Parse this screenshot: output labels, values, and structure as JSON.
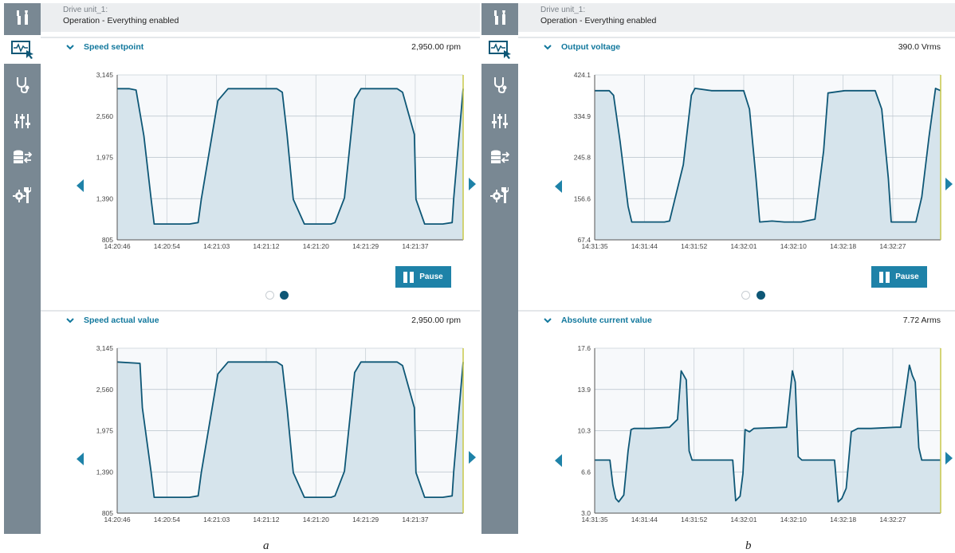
{
  "colors": {
    "sidebar": "#798893",
    "accent": "#1e82a8",
    "title": "#12789d",
    "line": "#0e5776",
    "fill": "#d6e4ec",
    "plot_bg": "#f7f9fb",
    "cursor": "#c8c84a"
  },
  "sidebar_icons": [
    "tools-icon",
    "monitor-trace-icon",
    "stethoscope-icon",
    "sliders-icon",
    "database-transfer-icon",
    "settings-wrench-icon"
  ],
  "panels": [
    {
      "caption": "a",
      "header": {
        "unit": "Drive unit_1:",
        "state": "Operation - Everything enabled"
      },
      "charts": [
        {
          "title": "Speed setpoint",
          "value": "2,950.00 rpm"
        },
        {
          "title": "Speed actual value",
          "value": "2,950.00 rpm"
        }
      ],
      "pause_label": "Pause",
      "pager": {
        "pages": 2,
        "active": 1
      }
    },
    {
      "caption": "b",
      "header": {
        "unit": "Drive unit_1:",
        "state": "Operation - Everything enabled"
      },
      "charts": [
        {
          "title": "Output voltage",
          "value": "390.0 Vrms"
        },
        {
          "title": "Absolute current value",
          "value": "7.72 Arms"
        }
      ],
      "pause_label": "Pause",
      "pager": {
        "pages": 2,
        "active": 1
      }
    }
  ],
  "chart_data": [
    {
      "type": "area",
      "title": "Speed setpoint",
      "unit": "rpm",
      "ylim": [
        805,
        3145
      ],
      "y_ticks": [
        "3,145",
        "2,560",
        "1,975",
        "1,390",
        "805"
      ],
      "x_ticks": [
        "14:20:46",
        "14:20:54",
        "14:21:03",
        "14:21:12",
        "14:21:20",
        "14:21:29",
        "14:21:37"
      ],
      "x_seconds": [
        0,
        1.5,
        2.4,
        3.4,
        4.3,
        4.7,
        6.3,
        7.4,
        9.2,
        10.3,
        10.7,
        12.8,
        14.1,
        15.1,
        16.1,
        16.6,
        18.2,
        19.0,
        20.3,
        21.0,
        21.6,
        22.4,
        23.8,
        24.6,
        26.2,
        27.2,
        27.7,
        28.9,
        30.2,
        31.0,
        32.1,
        33.8,
        34.5,
        35.6,
        36.3,
        37.8,
        38.0,
        39.1,
        40.5,
        41.4,
        42.6,
        42.8,
        44.0
      ],
      "values": [
        2950,
        2950,
        2930,
        2280,
        1400,
        1030,
        1030,
        1030,
        1030,
        1050,
        1380,
        2780,
        2950,
        2950,
        2950,
        2950,
        2950,
        2950,
        2950,
        2900,
        2300,
        1380,
        1030,
        1030,
        1030,
        1030,
        1050,
        1400,
        2800,
        2950,
        2950,
        2950,
        2950,
        2950,
        2900,
        2300,
        1380,
        1030,
        1030,
        1030,
        1050,
        1400,
        2950
      ],
      "x_end": 44.0,
      "grid": true
    },
    {
      "type": "area",
      "title": "Speed actual value",
      "unit": "rpm",
      "ylim": [
        805,
        3145
      ],
      "y_ticks": [
        "3,145",
        "2,560",
        "1,975",
        "1,390",
        "805"
      ],
      "x_ticks": [
        "14:20:46",
        "14:20:54",
        "14:21:03",
        "14:21:12",
        "14:21:20",
        "14:21:29",
        "14:21:37"
      ],
      "x_seconds": [
        0,
        2.9,
        3.2,
        4.3,
        4.7,
        6.3,
        7.4,
        9.2,
        10.3,
        10.7,
        12.8,
        14.1,
        15.1,
        16.1,
        16.6,
        18.2,
        19.0,
        20.3,
        21.0,
        21.6,
        22.4,
        23.8,
        24.6,
        26.2,
        27.2,
        27.7,
        28.9,
        30.2,
        31.0,
        32.1,
        33.8,
        34.5,
        35.6,
        36.3,
        37.8,
        38.0,
        39.1,
        40.5,
        41.4,
        42.6,
        42.8,
        44.0
      ],
      "values": [
        2950,
        2930,
        2300,
        1400,
        1030,
        1030,
        1030,
        1030,
        1050,
        1380,
        2780,
        2950,
        2950,
        2950,
        2950,
        2950,
        2950,
        2950,
        2900,
        2300,
        1380,
        1030,
        1030,
        1030,
        1030,
        1050,
        1400,
        2800,
        2950,
        2950,
        2950,
        2950,
        2950,
        2900,
        2300,
        1380,
        1030,
        1030,
        1030,
        1050,
        1400,
        2950
      ],
      "x_end": 44.0,
      "grid": true
    },
    {
      "type": "area",
      "title": "Output voltage",
      "unit": "Vrms",
      "ylim": [
        67.4,
        424.1
      ],
      "y_ticks": [
        "424.1",
        "334.9",
        "245.8",
        "156.6",
        "67.4"
      ],
      "x_ticks": [
        "14:31:35",
        "14:31:44",
        "14:31:52",
        "14:32:01",
        "14:32:10",
        "14:32:18",
        "14:32:27"
      ],
      "x_seconds": [
        0,
        2.0,
        2.6,
        3.5,
        4.6,
        5.1,
        6.4,
        8.0,
        9.6,
        10.3,
        12.2,
        13.3,
        13.8,
        16.1,
        18.3,
        20.1,
        20.5,
        21.3,
        22.2,
        22.7,
        24.4,
        26.1,
        27.4,
        28.4,
        30.3,
        31.5,
        32.1,
        34.4,
        36.2,
        38.3,
        38.6,
        39.5,
        40.4,
        40.8,
        42.5,
        43.6,
        44.2,
        45.0,
        46.0,
        46.9,
        47.6
      ],
      "values": [
        390,
        390,
        380,
        280,
        140,
        106,
        106,
        106,
        106,
        108,
        230,
        380,
        395,
        390,
        390,
        390,
        390,
        350,
        200,
        106,
        108,
        106,
        106,
        106,
        112,
        260,
        385,
        390,
        390,
        390,
        390,
        350,
        200,
        106,
        106,
        106,
        106,
        160,
        290,
        395,
        390
      ],
      "x_end": 47.6,
      "grid": true
    },
    {
      "type": "area",
      "title": "Absolute current value",
      "unit": "Arms",
      "ylim": [
        3.0,
        17.6
      ],
      "y_ticks": [
        "17.6",
        "13.9",
        "10.3",
        "6.6",
        "3.0"
      ],
      "x_ticks": [
        "14:31:35",
        "14:31:44",
        "14:31:52",
        "14:32:01",
        "14:32:10",
        "14:32:18",
        "14:32:27"
      ],
      "x_seconds": [
        0,
        2.1,
        2.5,
        2.9,
        3.3,
        4.0,
        4.6,
        5.0,
        5.4,
        7.5,
        10.3,
        11.4,
        11.9,
        12.6,
        13.0,
        13.4,
        14.0,
        15.2,
        19.0,
        19.4,
        20.0,
        20.4,
        20.7,
        21.3,
        21.9,
        26.4,
        27.2,
        27.6,
        28.0,
        28.5,
        29.4,
        31.9,
        33.0,
        33.5,
        34.0,
        34.6,
        35.3,
        36.2,
        38.0,
        41.5,
        42.1,
        43.3,
        43.7,
        44.1,
        44.6,
        45.0,
        45.5,
        47.6
      ],
      "values": [
        7.7,
        7.7,
        5.5,
        4.3,
        4.0,
        4.6,
        8.5,
        10.4,
        10.5,
        10.5,
        10.6,
        11.3,
        15.6,
        14.8,
        8.5,
        7.7,
        7.7,
        7.7,
        7.7,
        4.1,
        4.5,
        6.5,
        10.4,
        10.2,
        10.5,
        10.6,
        15.6,
        14.6,
        8.0,
        7.7,
        7.7,
        7.7,
        7.7,
        4.0,
        4.3,
        5.2,
        10.2,
        10.5,
        10.5,
        10.6,
        10.6,
        16.1,
        15.2,
        14.6,
        8.8,
        7.7,
        7.7,
        7.7
      ],
      "x_end": 47.6,
      "grid": true
    }
  ]
}
